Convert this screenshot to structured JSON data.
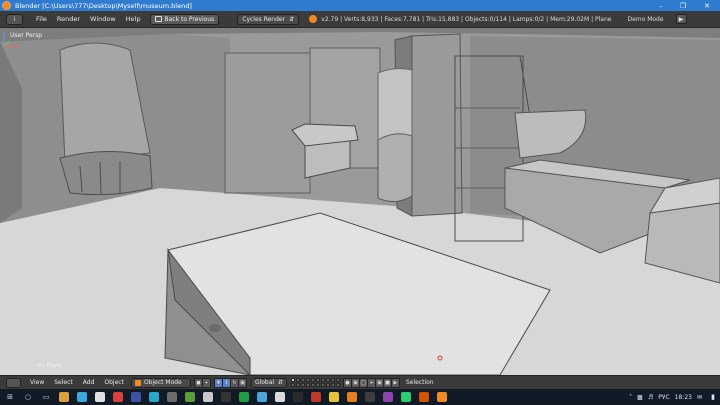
{
  "window": {
    "title": "Blender [C:\\Users\\777\\Desktop\\Myself\\museum.blend]",
    "minimize": "–",
    "maximize": "❐",
    "close": "✕"
  },
  "info_header": {
    "editor_icon": "i",
    "menu": [
      "File",
      "Render",
      "Window",
      "Help"
    ],
    "back_button": "Back to Previous",
    "render_engine": "Cycles Render",
    "stats": "v2.79 | Verts:8,933 | Faces:7,781 | Tris:15,883 | Objects:0/114 | Lamps:0/2 | Mem:29.02M | Plane",
    "demo_mode": "Demo Mode",
    "play_icon": "▶"
  },
  "viewport": {
    "view_name": "User Persp",
    "active_object": "(0) Plane",
    "background_color": "#9a9a9a",
    "axis_labels": {
      "x": "x",
      "z": "z"
    }
  },
  "view3d_header": {
    "menu": [
      "View",
      "Select",
      "Add",
      "Object"
    ],
    "mode": "Object Mode",
    "pivot_icon": "●",
    "manipulators": [
      "↕",
      "↻",
      "▣"
    ],
    "transform_orientation": "Global",
    "layers_active_index": 0,
    "selection_label": "Selection"
  },
  "taskbar": {
    "start_icon": "windows-icon",
    "apps": [
      {
        "name": "search-icon",
        "glyph": "○",
        "color": "#cfd8e6"
      },
      {
        "name": "task-view-icon",
        "glyph": "▭",
        "color": "#cfd8e6"
      },
      {
        "name": "app-1",
        "glyph": "",
        "color": "#d9a03c"
      },
      {
        "name": "app-2",
        "glyph": "",
        "color": "#3ca8d9"
      },
      {
        "name": "app-3",
        "glyph": "",
        "color": "#e0e0e0"
      },
      {
        "name": "app-4",
        "glyph": "",
        "color": "#d94040"
      },
      {
        "name": "app-5",
        "glyph": "",
        "color": "#3a53a3"
      },
      {
        "name": "app-6",
        "glyph": "",
        "color": "#2aa6c9"
      },
      {
        "name": "app-7",
        "glyph": "",
        "color": "#6c6c6c"
      },
      {
        "name": "app-8",
        "glyph": "",
        "color": "#5b9b3a"
      },
      {
        "name": "app-9",
        "glyph": "",
        "color": "#c9c9c9"
      },
      {
        "name": "app-10",
        "glyph": "",
        "color": "#333333"
      },
      {
        "name": "app-11",
        "glyph": "",
        "color": "#1f9e4a"
      },
      {
        "name": "app-12",
        "glyph": "",
        "color": "#4aa5d9"
      },
      {
        "name": "app-13",
        "glyph": "",
        "color": "#d9d9d9"
      },
      {
        "name": "app-14",
        "glyph": "",
        "color": "#2b2b2b"
      },
      {
        "name": "app-15",
        "glyph": "",
        "color": "#c0392b"
      },
      {
        "name": "app-16",
        "glyph": "",
        "color": "#e8c13d"
      },
      {
        "name": "app-17",
        "glyph": "",
        "color": "#e67e22"
      },
      {
        "name": "app-18",
        "glyph": "",
        "color": "#3d3d3d"
      },
      {
        "name": "app-19",
        "glyph": "",
        "color": "#8e44ad"
      },
      {
        "name": "app-20",
        "glyph": "",
        "color": "#2ecc71"
      },
      {
        "name": "app-21",
        "glyph": "",
        "color": "#d35400"
      },
      {
        "name": "app-22",
        "glyph": "",
        "color": "#f08a24"
      }
    ],
    "language": "РУС",
    "time": "18:23",
    "notification_icon": "✉"
  }
}
